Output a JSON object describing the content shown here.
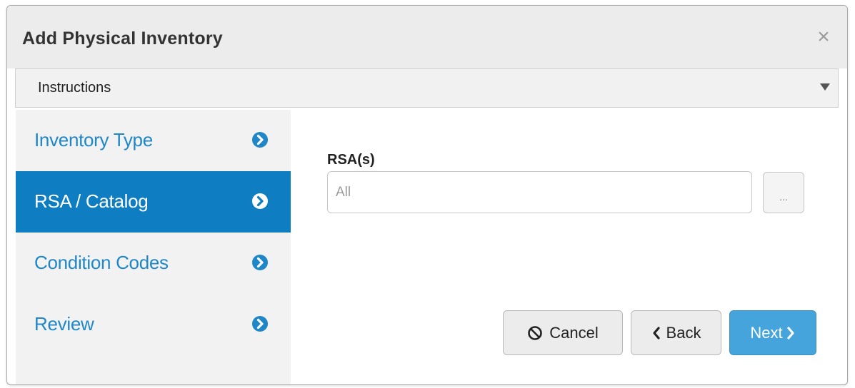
{
  "dialog": {
    "title": "Add Physical Inventory",
    "close_glyph": "×",
    "close_icon": "close-icon"
  },
  "instructions": {
    "label": "Instructions",
    "expand_icon": "caret-down-icon"
  },
  "steps": [
    {
      "label": "Inventory Type",
      "active": false,
      "icon": "chevron-right-circle-icon"
    },
    {
      "label": "RSA / Catalog",
      "active": true,
      "icon": "chevron-right-circle-icon"
    },
    {
      "label": "Condition Codes",
      "active": false,
      "icon": "chevron-right-circle-icon"
    },
    {
      "label": "Review",
      "active": false,
      "icon": "chevron-right-circle-icon"
    }
  ],
  "form": {
    "rsa_label": "RSA(s)",
    "rsa_value": "",
    "rsa_placeholder": "All",
    "lookup_label": "..."
  },
  "buttons": {
    "cancel_label": "Cancel",
    "cancel_icon": "ban-icon",
    "back_label": "Back",
    "back_icon": "chevron-left-icon",
    "next_label": "Next",
    "next_icon": "chevron-right-icon"
  },
  "colors": {
    "accent": "#0f7dc2",
    "link": "#1f87c7",
    "primary_button": "#45a4dc",
    "titlebar": "#ececec",
    "sidebar": "#f2f2f2"
  }
}
